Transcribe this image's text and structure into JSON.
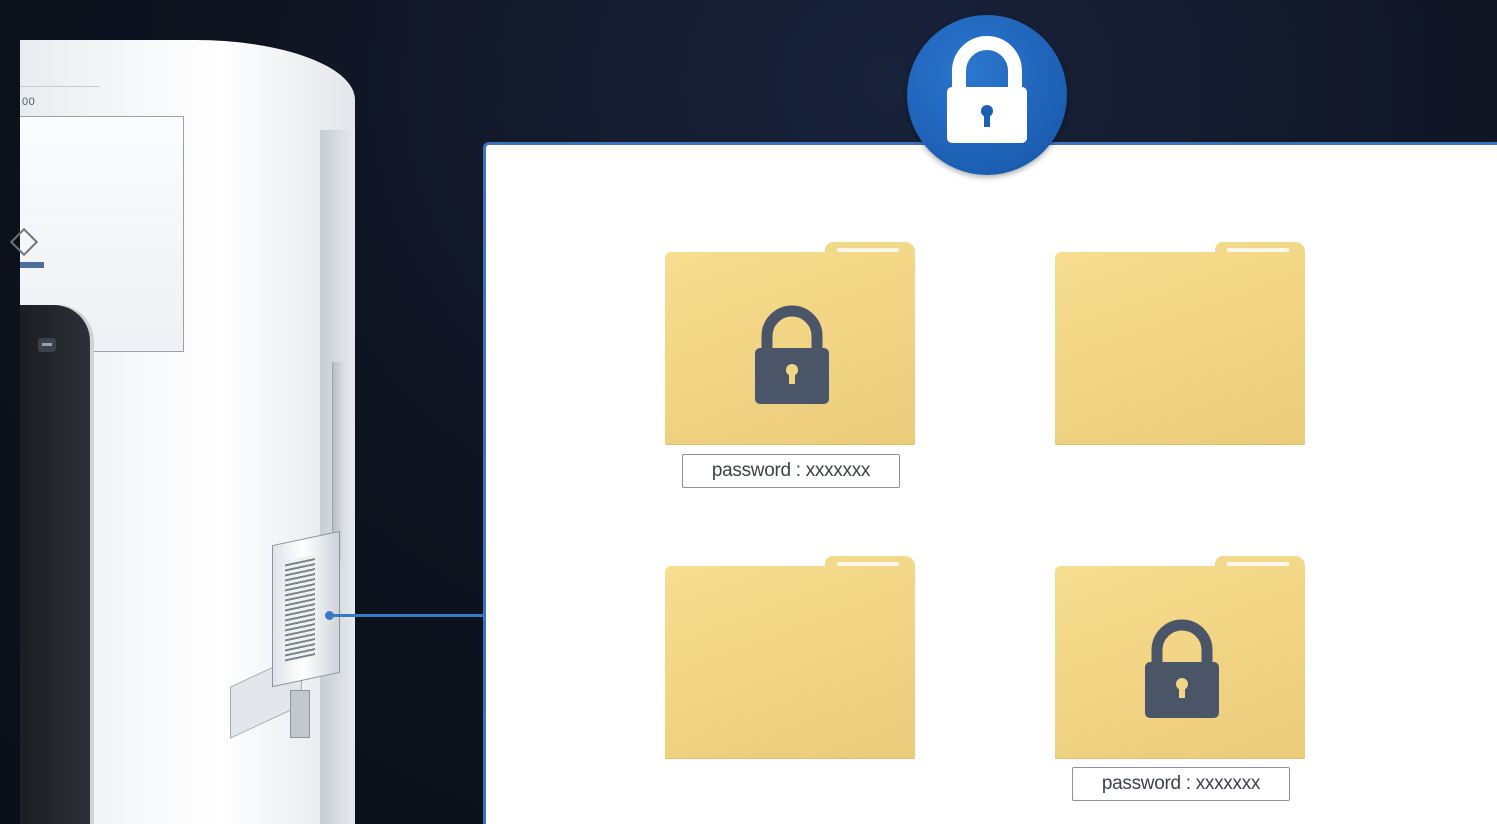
{
  "printer": {
    "model_fragment": "00"
  },
  "storage": {
    "folders": [
      {
        "locked": true,
        "password_label": "password : xxxxxxx"
      },
      {
        "locked": false,
        "password_label": ""
      },
      {
        "locked": false,
        "password_label": ""
      },
      {
        "locked": true,
        "password_label": "password : xxxxxxx"
      }
    ]
  },
  "colors": {
    "background": "#0d121d",
    "accent_blue": "#1c5fb3",
    "folder_yellow": "#f2d585",
    "lock_slate": "#4a5568"
  },
  "icons": {
    "badge": "padlock-icon",
    "folder_lock": "padlock-icon"
  }
}
